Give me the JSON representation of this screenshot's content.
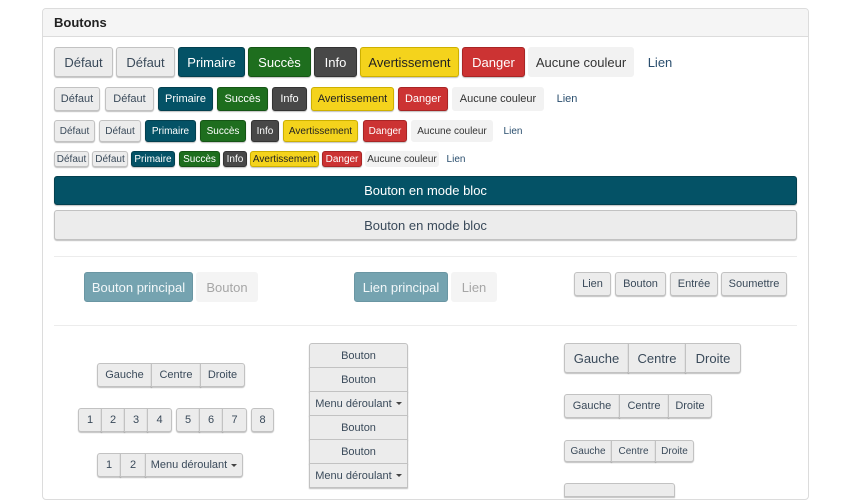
{
  "panel": {
    "title": "Boutons"
  },
  "rows": {
    "lg": [
      "Défaut",
      "Défaut",
      "Primaire",
      "Succès",
      "Info",
      "Avertissement",
      "Danger",
      "Aucune couleur",
      "Lien"
    ],
    "md": [
      "Défaut",
      "Défaut",
      "Primaire",
      "Succès",
      "Info",
      "Avertissement",
      "Danger",
      "Aucune couleur",
      "Lien"
    ],
    "sm": [
      "Défaut",
      "Défaut",
      "Primaire",
      "Succès",
      "Info",
      "Avertissement",
      "Danger",
      "Aucune couleur",
      "Lien"
    ],
    "xs": [
      "Défaut",
      "Défaut",
      "Primaire",
      "Succès",
      "Info",
      "Avertissement",
      "Danger",
      "Aucune couleur",
      "Lien"
    ]
  },
  "block": {
    "primary": "Bouton en mode bloc",
    "default": "Bouton en mode bloc"
  },
  "states": {
    "main_button": "Bouton principal",
    "button": "Bouton",
    "main_link": "Lien principal",
    "link": "Lien"
  },
  "types": [
    "Lien",
    "Bouton",
    "Entrée",
    "Soumettre"
  ],
  "align": {
    "left": "Gauche",
    "center": "Centre",
    "right": "Droite"
  },
  "pager": [
    "1",
    "2",
    "3",
    "4",
    "5",
    "6",
    "7",
    "8"
  ],
  "dropdown_group": {
    "one": "1",
    "two": "2",
    "menu": "Menu déroulant"
  },
  "vertical": [
    "Bouton",
    "Bouton",
    "Menu déroulant",
    "Bouton",
    "Bouton",
    "Menu déroulant"
  ],
  "colors": {
    "primary": "#045266",
    "success": "#1e6e1e",
    "info": "#484848",
    "warning": "#f4d31c",
    "danger": "#cc3333"
  }
}
